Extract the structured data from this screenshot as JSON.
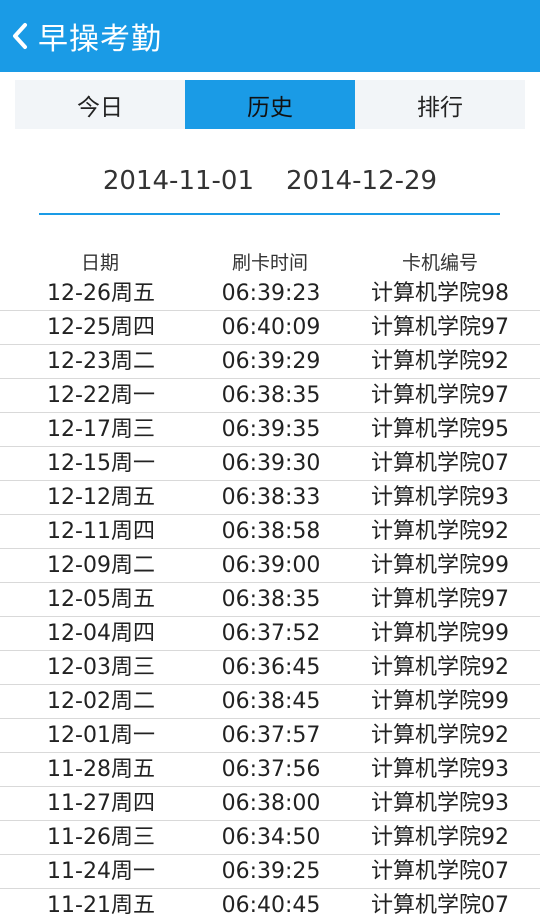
{
  "header": {
    "title": "早操考勤",
    "back_icon": "chevron-left-icon"
  },
  "colors": {
    "accent": "#1a9be6",
    "tab_bg": "#f2f5f8",
    "divider": "#d9d9d9"
  },
  "tabs": [
    {
      "label": "今日",
      "active": false
    },
    {
      "label": "历史",
      "active": true
    },
    {
      "label": "排行",
      "active": false
    }
  ],
  "date_range": {
    "start": "2014-11-01",
    "end": "2014-12-29"
  },
  "table": {
    "headers": [
      "日期",
      "刷卡时间",
      "卡机编号"
    ],
    "rows": [
      [
        "12-26周五",
        "06:39:23",
        "计算机学院98"
      ],
      [
        "12-25周四",
        "06:40:09",
        "计算机学院97"
      ],
      [
        "12-23周二",
        "06:39:29",
        "计算机学院92"
      ],
      [
        "12-22周一",
        "06:38:35",
        "计算机学院97"
      ],
      [
        "12-17周三",
        "06:39:35",
        "计算机学院95"
      ],
      [
        "12-15周一",
        "06:39:30",
        "计算机学院07"
      ],
      [
        "12-12周五",
        "06:38:33",
        "计算机学院93"
      ],
      [
        "12-11周四",
        "06:38:58",
        "计算机学院92"
      ],
      [
        "12-09周二",
        "06:39:00",
        "计算机学院99"
      ],
      [
        "12-05周五",
        "06:38:35",
        "计算机学院97"
      ],
      [
        "12-04周四",
        "06:37:52",
        "计算机学院99"
      ],
      [
        "12-03周三",
        "06:36:45",
        "计算机学院92"
      ],
      [
        "12-02周二",
        "06:38:45",
        "计算机学院99"
      ],
      [
        "12-01周一",
        "06:37:57",
        "计算机学院92"
      ],
      [
        "11-28周五",
        "06:37:56",
        "计算机学院93"
      ],
      [
        "11-27周四",
        "06:38:00",
        "计算机学院93"
      ],
      [
        "11-26周三",
        "06:34:50",
        "计算机学院92"
      ],
      [
        "11-24周一",
        "06:39:25",
        "计算机学院07"
      ],
      [
        "11-21周五",
        "06:40:45",
        "计算机学院07"
      ]
    ]
  }
}
